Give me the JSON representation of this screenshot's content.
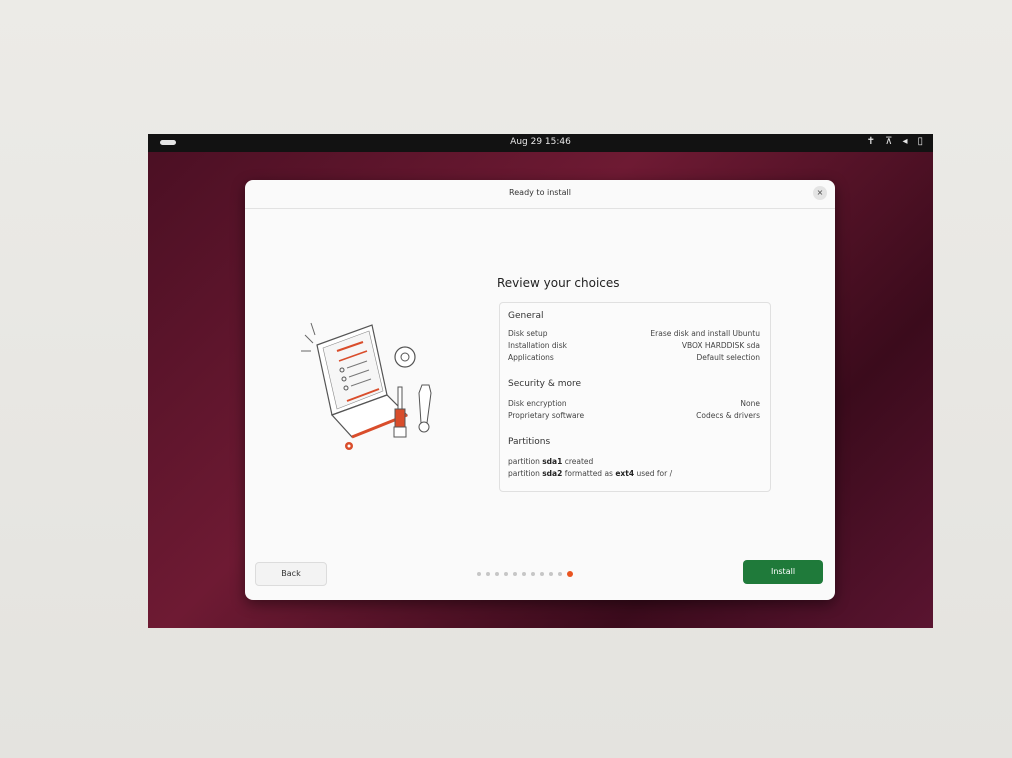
{
  "topbar": {
    "clock": "Aug 29  15:46",
    "tray_icons": [
      "accessibility-icon",
      "network-icon",
      "volume-icon",
      "battery-icon"
    ]
  },
  "dialog": {
    "title": "Ready to install",
    "close_glyph": "×",
    "review_title": "Review your choices",
    "general": {
      "title": "General",
      "rows": [
        {
          "k": "Disk setup",
          "v": "Erase disk and install Ubuntu"
        },
        {
          "k": "Installation disk",
          "v": "VBOX HARDDISK sda"
        },
        {
          "k": "Applications",
          "v": "Default selection"
        }
      ]
    },
    "security": {
      "title": "Security & more",
      "rows": [
        {
          "k": "Disk encryption",
          "v": "None"
        },
        {
          "k": "Proprietary software",
          "v": "Codecs & drivers"
        }
      ]
    },
    "partitions": {
      "title": "Partitions",
      "line1_pre": "partition ",
      "line1_bold": "sda1",
      "line1_post": " created",
      "line2_pre": "partition ",
      "line2_bold": "sda2",
      "line2_mid": " formatted as ",
      "line2_bold2": "ext4",
      "line2_post": " used for /"
    },
    "back_label": "Back",
    "install_label": "Install",
    "progress": {
      "total_steps": 11,
      "current_step": 11
    }
  },
  "colors": {
    "accent_orange": "#e95420",
    "install_green": "#1f7a3a",
    "desktop_maroon": "#5a1430"
  }
}
